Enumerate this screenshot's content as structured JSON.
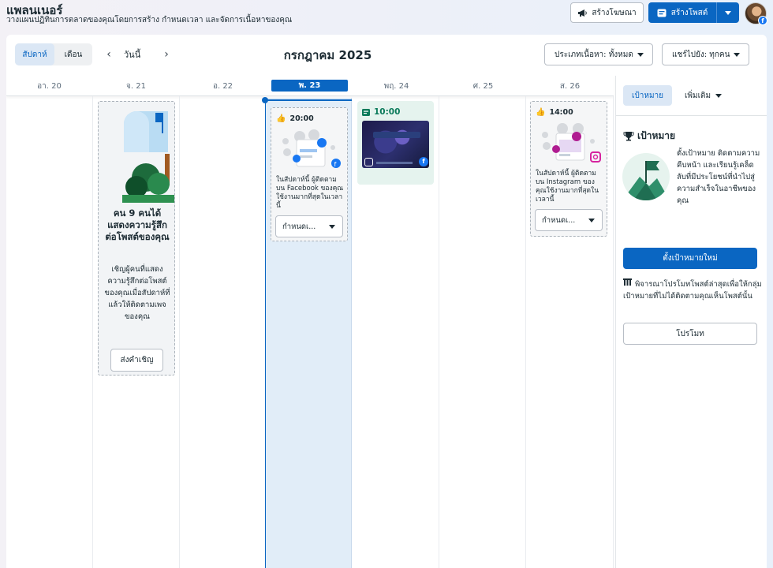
{
  "header": {
    "title": "แพลนเนอร์",
    "subtitle": "วางแผนปฏิทินการตลาดของคุณโดยการสร้าง กำหนดเวลา และจัดการเนื้อหาของคุณ",
    "create_ad_label": "สร้างโฆษณา",
    "create_post_label": "สร้างโพสต์"
  },
  "toolbar": {
    "view_week": "สัปดาห์",
    "view_month": "เดือน",
    "today": "วันนี้",
    "prev_icon": "‹",
    "next_icon": "›",
    "month_title": "กรกฎาคม 2025",
    "content_type_filter": "ประเภทเนื้อหา: ทั้งหมด",
    "shared_to_filter": "แชร์ไปยัง: ทุกคน"
  },
  "calendar": {
    "days": [
      "อา. 20",
      "จ. 21",
      "อ. 22",
      "พ. 23",
      "พฤ. 24",
      "ศ. 25",
      "ส. 26"
    ],
    "today_index": 3,
    "invite_card": {
      "title": "คน 9 คนได้แสดงความรู้สึกต่อโพสต์ของคุณ",
      "description": "เชิญผู้คนที่แสดงความรู้สึกต่อโพสต์ของคุณเมื่อสัปดาห์ที่แล้วให้ติดตามเพจของคุณ",
      "button": "ส่งคำเชิญ"
    },
    "suggestions": [
      {
        "time": "20:00",
        "text": "ในสัปดาห์นี้ ผู้ติดตามบน Facebook ของคุณใช้งานมากที่สุดในเวลานี้",
        "button": "กำหนดเ..."
      },
      {
        "time": "14:00",
        "text": "ในสัปดาห์นี้ ผู้ติดตามบน Instagram ของคุณใช้งานมากที่สุดในเวลานี้",
        "button": "กำหนดเ..."
      }
    ],
    "scheduled_post": {
      "time": "10:00"
    }
  },
  "right_panel": {
    "tab_goals": "เป้าหมาย",
    "tab_more": "เพิ่มเติม",
    "goal_heading": "เป้าหมาย",
    "goal_description": "ตั้งเป้าหมาย ติดตามความคืบหน้า และเรียนรู้เคล็ดลับที่มีประโยชน์ที่นำไปสู่ความสำเร็จในอาชีพของคุณ",
    "goal_button": "ตั้งเป้าหมายใหม่",
    "promo_text": "พิจารณาโปรโมทโพสต์ล่าสุดเพื่อให้กลุ่มเป้าหมายที่ไม่ได้ติดตามคุณเห็นโพสต์นั้น",
    "promo_button": "โปรโมท"
  },
  "colors": {
    "brand_blue": "#0a66c2",
    "today_bg": "#e1edf8",
    "scheduled_bg": "#e5f3ee"
  },
  "icons": [
    "megaphone-icon",
    "post-icon",
    "chevron-down-icon",
    "chevron-left-icon",
    "chevron-right-icon",
    "trophy-icon",
    "promo-icon",
    "facebook-icon",
    "instagram-icon",
    "thumbs-up-icon",
    "calendar-icon"
  ]
}
